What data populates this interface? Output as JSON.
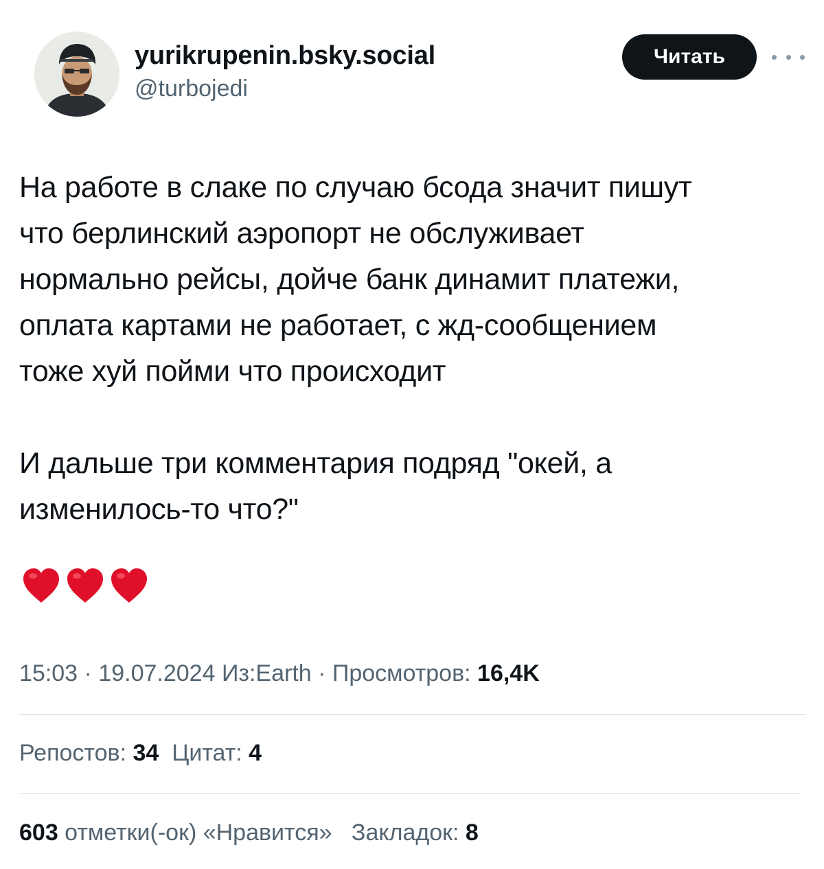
{
  "author": {
    "display_name": "yurikrupenin.bsky.social",
    "handle": "@turbojedi"
  },
  "follow_button": {
    "label": "Читать"
  },
  "more_menu": {
    "icon": "more-horizontal-icon"
  },
  "tweet": {
    "lines": [
      "На работе в слаке по случаю бсода значит пишут",
      "что берлинский аэропорт не обслуживает",
      "нормально рейсы, дойче банк динамит платежи,",
      "оплата картами не работает, с жд-сообщением",
      "тоже хуй пойми что происходит"
    ],
    "lines2": [
      "И дальше три комментария подряд \"окей, а",
      "изменилось-то что?\""
    ],
    "emoji": [
      "heart-icon",
      "heart-icon",
      "heart-icon"
    ],
    "heart_color": "#e0102a"
  },
  "meta": {
    "time": "15:03",
    "sep1": " · ",
    "date": "19.07.2024",
    "source": "Из:Earth",
    "sep2": " · ",
    "views_label": "Просмотров: ",
    "views_value": "16,4K"
  },
  "stats": {
    "reposts_label": "Репостов: ",
    "reposts_value": "34",
    "quotes_label": "Цитат: ",
    "quotes_value": "4",
    "likes_value": "603",
    "likes_label": " отметки(-ок) «Нравится»",
    "bookmarks_label": "Закладок: ",
    "bookmarks_value": "8"
  },
  "colors": {
    "text": "#0f1419",
    "secondary": "#536471",
    "divider": "#cfd9de",
    "button_bg": "#0f1419"
  }
}
